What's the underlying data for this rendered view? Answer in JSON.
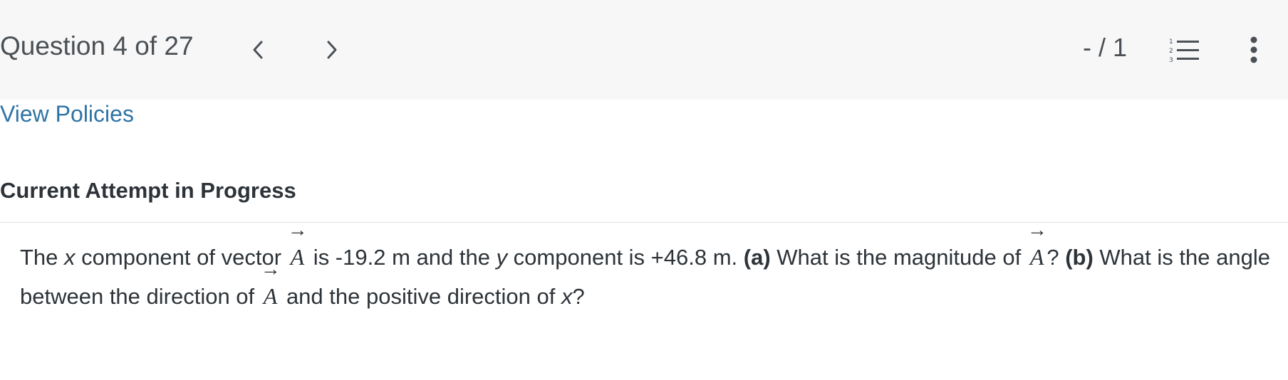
{
  "header": {
    "question_label": "Question 4 of 27",
    "score": "- / 1",
    "prev_icon": "chevron-left-icon",
    "next_icon": "chevron-right-icon",
    "list_icon": "numbered-list-icon",
    "more_icon": "more-vertical-icon"
  },
  "links": {
    "view_policies": "View Policies"
  },
  "attempt": {
    "title": "Current Attempt in Progress"
  },
  "question": {
    "p1": "The ",
    "x1": "x",
    "p2": " component of vector ",
    "vec_symbol": "A",
    "vec_arrow": "→",
    "p3": " is -19.2 m and the ",
    "y1": "y",
    "p4": " component is +46.8 m. ",
    "part_a": "(a)",
    "p5": " What is the magnitude of ",
    "p6": "? ",
    "part_b": "(b)",
    "p7": " What is the angle between the direction of ",
    "p8": " and the positive direction of ",
    "x2": "x",
    "p9": "?"
  },
  "colors": {
    "header_bg": "#f7f7f7",
    "link": "#2f74a6",
    "text": "#2d3338"
  }
}
